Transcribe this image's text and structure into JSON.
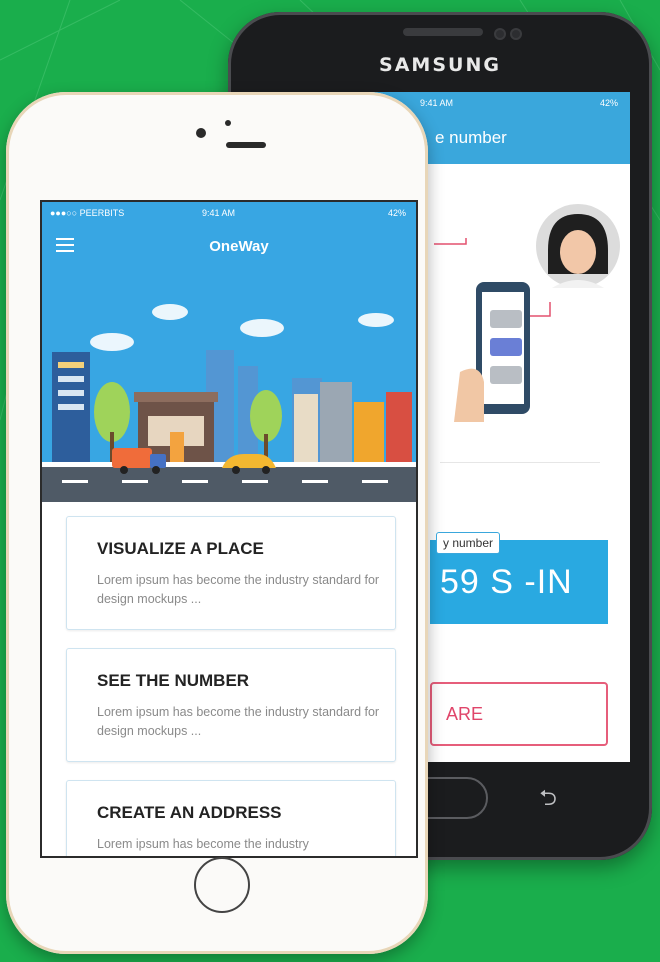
{
  "background": {
    "color": "#1aae4c"
  },
  "samsung": {
    "brand": "SAMSUNG",
    "status_time": "9:41 AM",
    "status_battery": "42%",
    "appbar_title": "e number",
    "code_tag": "y number",
    "code_value": "59 S -IN",
    "share_label": "ARE",
    "back_glyph": "⮌"
  },
  "iphone": {
    "status_carrier": "●●●○○ PEERBITS",
    "status_time": "9:41 AM",
    "status_battery": "42%",
    "app_title": "OneWay",
    "cards": [
      {
        "title": "VISUALIZE A PLACE",
        "desc": "Lorem ipsum has become the industry standard for design mockups ..."
      },
      {
        "title": "SEE THE NUMBER",
        "desc": "Lorem ipsum has become the industry standard for design mockups ..."
      },
      {
        "title": "CREATE AN ADDRESS",
        "desc": "Lorem ipsum has become the industry"
      }
    ]
  },
  "colors": {
    "accent_blue": "#38a6e3",
    "share_pink": "#e0456a"
  }
}
